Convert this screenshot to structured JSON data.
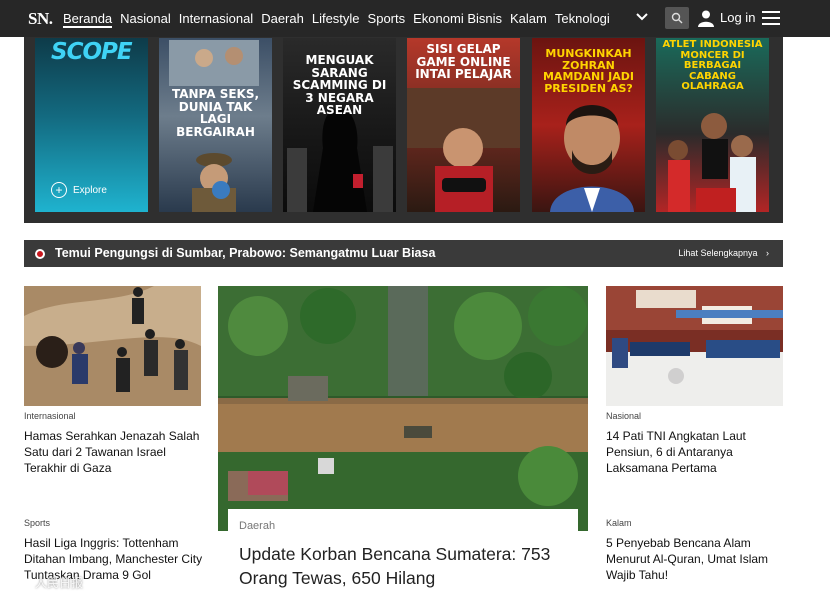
{
  "nav": {
    "logo": "SN.",
    "links": [
      "Beranda",
      "Nasional",
      "Internasional",
      "Daerah",
      "Lifestyle",
      "Sports",
      "Ekonomi Bisnis",
      "Kalam",
      "Teknologi"
    ],
    "login_label": "Log in",
    "icons": [
      "chevron-down-icon",
      "search-icon",
      "user-icon",
      "hamburger-menu-icon"
    ]
  },
  "stories": {
    "scope_logo": "SCOPE",
    "explore_label": "Explore",
    "items": [
      {
        "title": "TANPA SEKS, DUNIA TAK LAGI BERGAIRAH",
        "accent": "#ffd400"
      },
      {
        "title": "MENGUAK SARANG SCAMMING DI 3 NEGARA ASEAN",
        "accent": "#ffffff"
      },
      {
        "title": "SISI GELAP GAME ONLINE INTAI PELAJAR",
        "accent": "#ffffff"
      },
      {
        "title": "MUNGKINKAH ZOHRAN MAMDANI JADI PRESIDEN AS?",
        "accent": "#ffd400"
      },
      {
        "title": "ATLET INDONESIA MONCER DI BERBAGAI CABANG OLAHRAGA",
        "accent": "#ffd400"
      }
    ]
  },
  "ticker": {
    "headline": "Temui Pengungsi di Sumbar, Prabowo: Semangatmu Luar Biasa",
    "more_label": "Lihat Selengkapnya"
  },
  "articles": {
    "left_top": {
      "category": "Internasional",
      "title": "Hamas Serahkan Jenazah Salah Satu dari 2 Tawanan Israel Terakhir di Gaza"
    },
    "left_bottom": {
      "category": "Sports",
      "title": "Hasil Liga Inggris: Tottenham Ditahan Imbang, Manchester City Tuntaskan Drama 9 Gol"
    },
    "main": {
      "category": "Daerah",
      "title": "Update Korban Bencana Sumatera: 753 Orang Tewas, 650 Hilang"
    },
    "right_top": {
      "category": "Nasional",
      "title": "14 Pati TNI Angkatan Laut Pensiun, 6 di Antaranya Laksamana Pertama"
    },
    "right_bottom": {
      "category": "Kalam",
      "title": "5 Penyebab Bencana Alam Menurut Al-Quran, Umat Islam Wajib Tahu!"
    }
  },
  "watermark": "人民日报"
}
